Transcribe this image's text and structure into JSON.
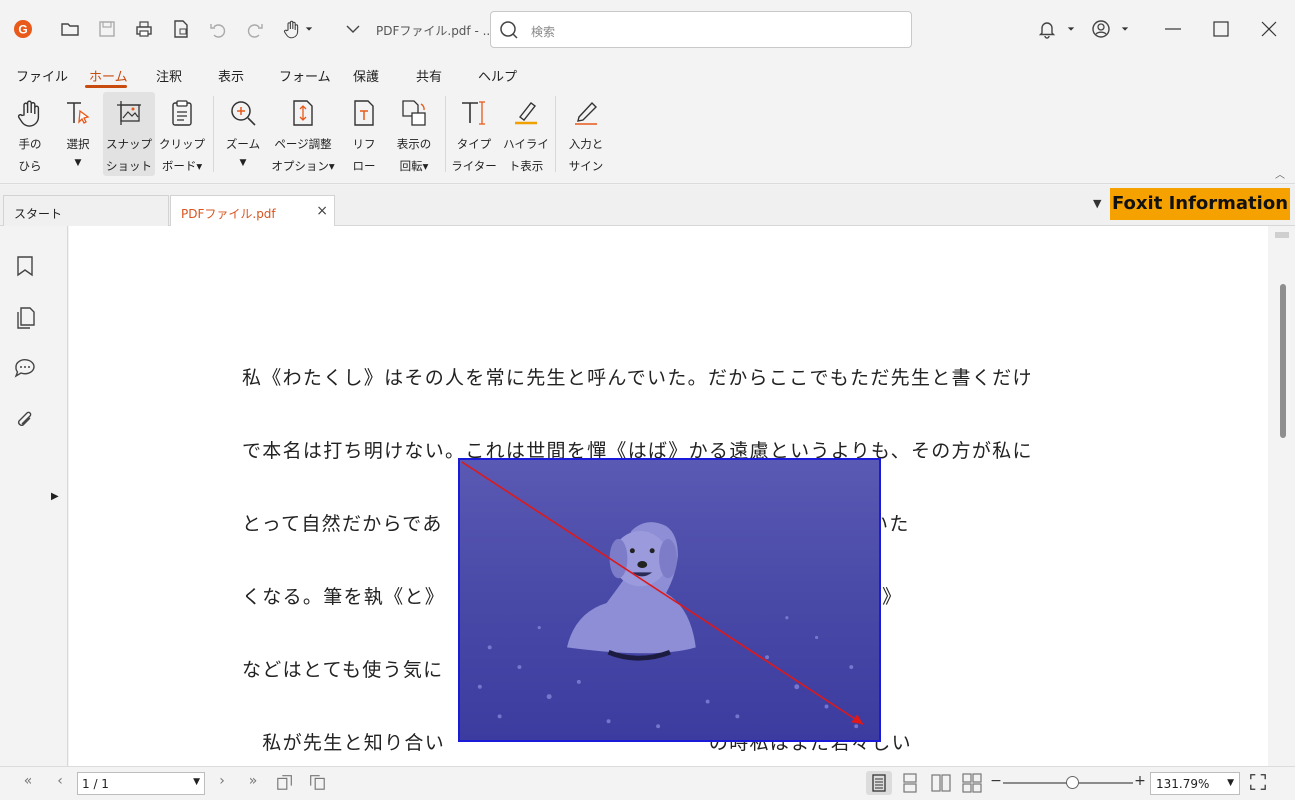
{
  "window": {
    "title": "PDFファイル.pdf - ...",
    "search_placeholder": "検索"
  },
  "menu": [
    "ファイル",
    "ホーム",
    "注釈",
    "表示",
    "フォーム",
    "保護",
    "共有",
    "ヘルプ"
  ],
  "menu_active": "ホーム",
  "ribbon": [
    {
      "l1": "手の",
      "l2": "ひら",
      "icon": "hand-icon"
    },
    {
      "l1": "選択",
      "l2": "▼",
      "icon": "select-text-icon"
    },
    {
      "l1": "スナップ",
      "l2": "ショット",
      "icon": "snapshot-icon",
      "selected": true
    },
    {
      "l1": "クリップ",
      "l2": "ボード▾",
      "icon": "clipboard-icon"
    },
    {
      "l1": "ズーム",
      "l2": "▼",
      "icon": "zoom-icon"
    },
    {
      "l1": "ページ調整",
      "l2": "オプション▾",
      "icon": "page-fit-icon"
    },
    {
      "l1": "リフ",
      "l2": "ロー",
      "icon": "reflow-icon"
    },
    {
      "l1": "表示の",
      "l2": "回転▾",
      "icon": "rotate-view-icon"
    },
    {
      "l1": "タイプ",
      "l2": "ライター",
      "icon": "typewriter-icon"
    },
    {
      "l1": "ハイライ",
      "l2": "ト表示",
      "icon": "highlight-icon"
    },
    {
      "l1": "入力と",
      "l2": "サイン",
      "icon": "fill-sign-icon"
    }
  ],
  "tabs": [
    {
      "label": "スタート"
    },
    {
      "label": "PDFファイル.pdf",
      "active": true,
      "close": "×"
    }
  ],
  "foxit_info": "Foxit Information",
  "document_lines": [
    "私《わたくし》はその人を常に先生と呼んでいた。だからここでもただ先生と書くだけ",
    "で本名は打ち明けない。これは世間を憚《はば》かる遠慮というよりも、その方が私に",
    "とって自然だからであ　　　　　　　　　　　　　すぐ「先生」といいた",
    "くなる。筆を執《と》　　　　　　　　　　　　　頭文字《かしらもじ》",
    "などはとても使う気に",
    "　私が先生と知り合い　　　　　　　　　　　　　の時私はまだ若々しい"
  ],
  "statusbar": {
    "page": "1 / 1",
    "zoom": "131.79%"
  },
  "colors": {
    "accent": "#c84b10",
    "foxit_banner": "#f5a100",
    "selection_border": "#1a1ad9",
    "arrow": "#e01818"
  }
}
